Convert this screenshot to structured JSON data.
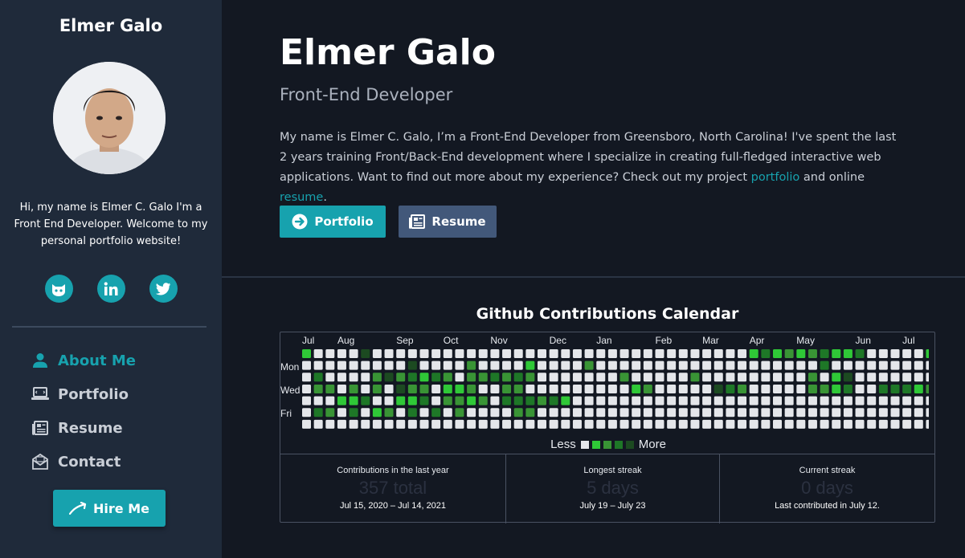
{
  "sidebar": {
    "name": "Elmer Galo",
    "intro": "Hi, my name is Elmer C. Galo I'm a Front End Developer. Welcome to my personal portfolio website!",
    "social": [
      {
        "icon": "github-icon"
      },
      {
        "icon": "linkedin-icon"
      },
      {
        "icon": "twitter-icon"
      }
    ],
    "nav": [
      {
        "label": "About Me",
        "icon": "person-icon",
        "active": true
      },
      {
        "label": "Portfolio",
        "icon": "laptop-icon",
        "active": false
      },
      {
        "label": "Resume",
        "icon": "document-icon",
        "active": false
      },
      {
        "label": "Contact",
        "icon": "envelope-icon",
        "active": false
      }
    ],
    "hire_label": "Hire Me"
  },
  "hero": {
    "title": "Elmer Galo",
    "subtitle": "Front-End Developer",
    "desc_before": "My name is Elmer C. Galo, I’m a Front-End Developer from Greensboro, North Carolina! I've spent the last 2 years training Front/Back-End development where I specialize in creating full-fledged interactive web applications. Want to find out more about my experience? Check out my project ",
    "link_portfolio": "portfolio",
    "desc_mid": " and online ",
    "link_resume": "resume",
    "desc_after": ".",
    "btn_portfolio": "Portfolio",
    "btn_resume": "Resume"
  },
  "calendar": {
    "title": "Github Contributions Calendar",
    "months": [
      "Jul",
      "Aug",
      "Sep",
      "Oct",
      "Nov",
      "Dec",
      "Jan",
      "Feb",
      "Mar",
      "Apr",
      "May",
      "Jun",
      "Jul"
    ],
    "month_weeks": [
      0,
      3,
      8,
      12,
      16,
      21,
      25,
      30,
      34,
      38,
      42,
      47,
      51
    ],
    "days": [
      "Mon",
      "Wed",
      "Fri"
    ],
    "legend_less": "Less",
    "legend_more": "More",
    "colors": [
      "#e4e6ea",
      "#2fc837",
      "#399435",
      "#1e7727",
      "#1c4a21"
    ],
    "grid": [
      "1000040000000000000000000000000000000013121231130000012000",
      "0000000004000020000100002000000000000000000030000000000000",
      "0300002423132022323200000002000002000000000201400000000212",
      "0220202042201120022000000000120000043200000221300333122001",
      "0001130011302212033323100000000000000000000000000000000000",
      "0320301203030200002200000000000000000000000000000000000000",
      "0000000000000000000000000000000000000000000000000000000000"
    ],
    "stats": [
      {
        "label": "Contributions in the last year",
        "value": "357 total",
        "range": "Jul 15, 2020 – Jul 14, 2021"
      },
      {
        "label": "Longest streak",
        "value": "5 days",
        "range": "July 19 – July 23"
      },
      {
        "label": "Current streak",
        "value": "0 days",
        "range": "Last contributed in July 12."
      }
    ]
  },
  "accent": "#17a2ae"
}
